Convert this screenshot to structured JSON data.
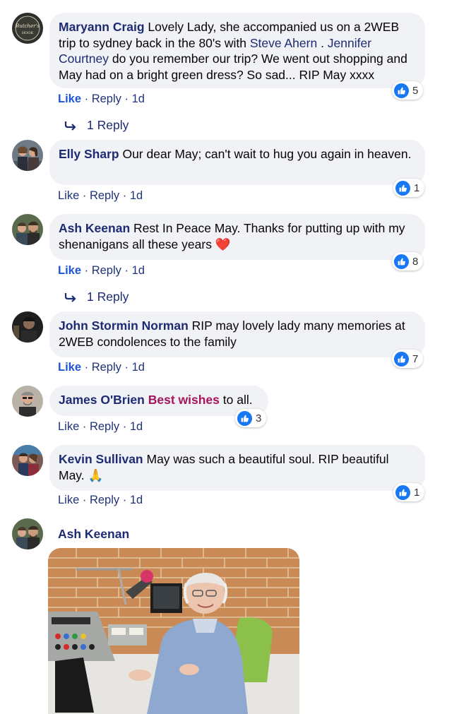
{
  "comments": [
    {
      "author": "Maryann Craig",
      "text_a": " Lovely Lady, she accompanied us on a 2WEB trip to sydney back in the 80's with ",
      "mention1": "Steve Ahern",
      "text_b": " . ",
      "mention2": "Jennifer Courtney",
      "text_c": " do you remember our trip? We went out shopping and May had on a bright green dress? So sad... RIP May xxxx",
      "like": "Like",
      "reply": "Reply",
      "time": "1d",
      "reactions": "5",
      "replies_label": "1 Reply",
      "avatar_text": "Butcher's Hook"
    },
    {
      "author": "Elly Sharp",
      "text": " Our dear May; can't wait to hug you again in heaven.",
      "like": "Like",
      "reply": "Reply",
      "time": "1d",
      "reactions": "1"
    },
    {
      "author": "Ash Keenan",
      "text": " Rest In Peace May. Thanks for putting up with my shenanigans all these years ",
      "emoji": "❤️",
      "like": "Like",
      "reply": "Reply",
      "time": "1d",
      "reactions": "8",
      "replies_label": "1 Reply"
    },
    {
      "author": "John Stormin Norman",
      "text": " RIP may lovely lady many memories at 2WEB condolences to the family",
      "like": "Like",
      "reply": "Reply",
      "time": "1d",
      "reactions": "7"
    },
    {
      "author": "James O'Brien",
      "highlight": "Best wishes",
      "text": " to all.",
      "like": "Like",
      "reply": "Reply",
      "time": "1d",
      "reactions": "3"
    },
    {
      "author": "Kevin Sullivan",
      "text": " May was such a beautiful soul. RIP beautiful May. ",
      "emoji": "🙏",
      "like": "Like",
      "reply": "Reply",
      "time": "1d",
      "reactions": "1"
    }
  ],
  "photo_comment": {
    "author": "Ash Keenan"
  },
  "separator": " · ",
  "icons": [
    "like-thumb-icon",
    "reply-arrow-icon"
  ],
  "colors": {
    "link": "#1c2b73",
    "like_blue": "#1d55d8",
    "bubble": "#f0f2f5",
    "reaction_blue": "#1877f2",
    "highlight_pink": "#a3175b"
  }
}
